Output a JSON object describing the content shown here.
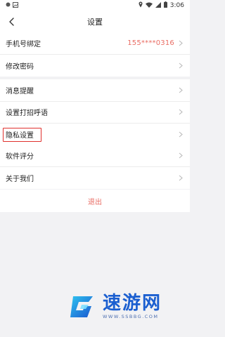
{
  "status_bar": {
    "time": "3:06",
    "icons": [
      "notification-dot-icon",
      "gallery-icon",
      "location-icon",
      "wifi-icon",
      "cellular-icon",
      "battery-icon"
    ]
  },
  "header": {
    "title": "设置",
    "back_icon": "chevron-left-icon"
  },
  "groups": [
    {
      "items": [
        {
          "label": "手机号绑定",
          "value": "155****0316"
        },
        {
          "label": "修改密码"
        }
      ]
    },
    {
      "items": [
        {
          "label": "消息提醒"
        },
        {
          "label": "设置打招呼语"
        },
        {
          "label": "隐私设置",
          "highlighted": true
        }
      ]
    },
    {
      "items": [
        {
          "label": "软件评分"
        },
        {
          "label": "关于我们"
        }
      ]
    }
  ],
  "logout_label": "退出",
  "watermark": {
    "title": "速游网",
    "url": "WWW.SSBBG.COM"
  },
  "colors": {
    "accent": "#e96d64",
    "highlight_border": "#e0302d",
    "background": "#f2f2f4",
    "watermark_blue": "#1b5fd0"
  }
}
